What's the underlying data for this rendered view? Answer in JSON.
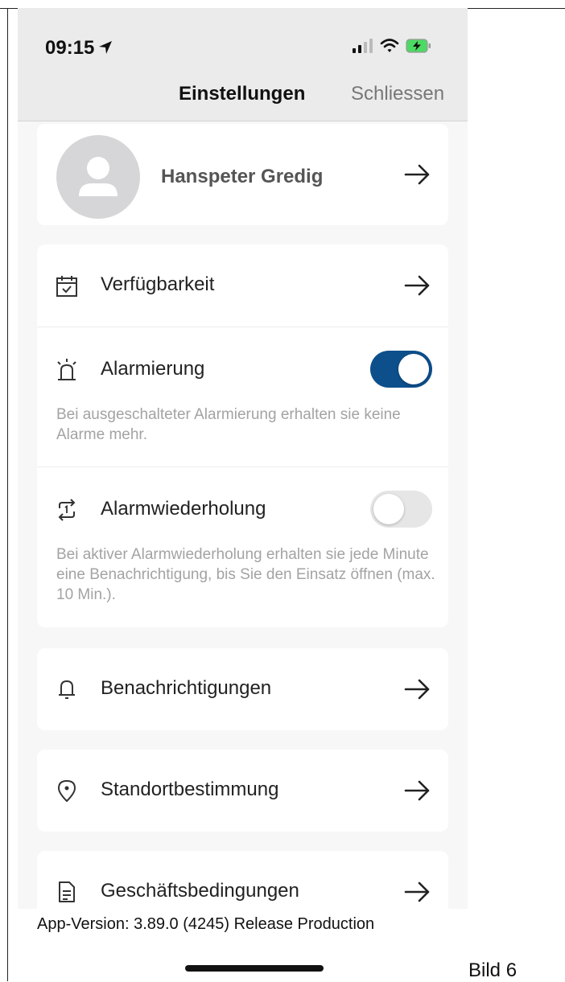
{
  "status_bar": {
    "time": "09:15"
  },
  "nav": {
    "title": "Einstellungen",
    "close_label": "Schliessen"
  },
  "profile": {
    "name": "Hanspeter Gredig"
  },
  "settings": {
    "availability": {
      "label": "Verfügbarkeit",
      "icon": "calendar-check-icon"
    },
    "alarming": {
      "label": "Alarmierung",
      "icon": "alarm-light-icon",
      "enabled": true,
      "description": "Bei ausgeschalteter Alarmierung erhalten sie keine Alarme mehr."
    },
    "alarm_repeat": {
      "label": "Alarmwiederholung",
      "icon": "repeat-one-icon",
      "enabled": false,
      "description": "Bei aktiver Alarmwiederholung erhalten sie jede Minute eine Benachrichtigung, bis Sie den Einsatz öffnen (max. 10 Min.)."
    },
    "notifications": {
      "label": "Benachrichtigungen",
      "icon": "bell-icon"
    },
    "location": {
      "label": "Standortbestimmung",
      "icon": "location-pin-icon"
    },
    "terms": {
      "label": "Geschäftsbedingungen",
      "icon": "document-icon"
    }
  },
  "footer": {
    "app_version": "App-Version: 3.89.0 (4245) Release Production"
  },
  "caption": "Bild 6",
  "colors": {
    "accent": "#0d4f8b",
    "toggle_off": "#e6e6e6",
    "topbar": "#ebebeb",
    "background": "#f7f7f7"
  }
}
